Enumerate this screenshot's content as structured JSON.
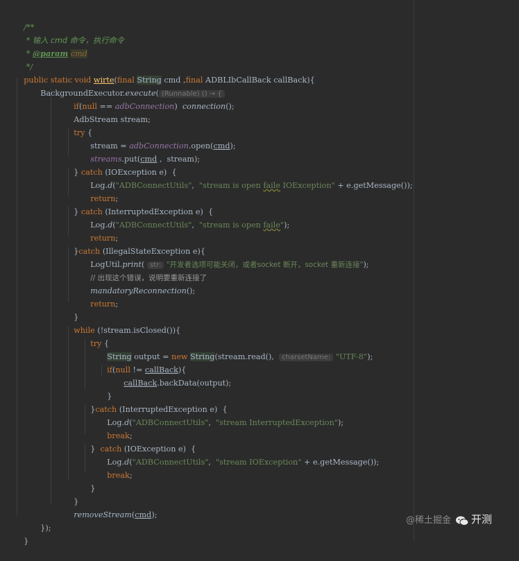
{
  "editor": {
    "lines": [
      {
        "doc_open": "/**"
      },
      {
        "doc_star": " * ",
        "doc_text": "输入 cmd 命令，执行命令"
      },
      {
        "doc_star": " * ",
        "doc_tag": "@param",
        "doc_param": "cmd"
      },
      {
        "doc_close": " */"
      },
      {
        "kw1": "public static void ",
        "name": "wirte",
        "p1": "(",
        "kw2": "final ",
        "t1": "String",
        "v1": " cmd ,",
        "kw3": "final ",
        "t2": "ADBLIbCallBack",
        "v2": " callBack){"
      },
      {
        "t": "BackgroundExecutor.",
        "i": "execute",
        "p": "(",
        "hint": "(Runnable) () → {"
      },
      {
        "kw": "if",
        "p1": "(",
        "kw2": "null",
        "p2": " == ",
        "f": "adbConnection",
        "p3": ")  ",
        "i": "connection",
        "p4": "();"
      },
      {
        "t": "AdbStream stream;"
      },
      {
        "kw": "try",
        "t": " {"
      },
      {
        "t": "stream = ",
        "f": "adbConnection",
        "t2": ".open(",
        "u": "cmd",
        "t3": ");"
      },
      {
        "f": "streams",
        "t": ".put(",
        "u": "cmd",
        "t2": " ,  stream);"
      },
      {
        "t1": "} ",
        "kw": "catch",
        "t2": " (IOException e)  {"
      },
      {
        "t": "Log.",
        "i": "d",
        "t2": "(",
        "s1": "\"ADBConnectUtils\"",
        "t3": ",  ",
        "s2": "\"stream is open ",
        "w": "faile",
        "s3": " IOException\"",
        "t4": " + e.getMessage());"
      },
      {
        "kw": "return",
        "t": ";"
      },
      {
        "t1": "} ",
        "kw": "catch",
        "t2": " (InterruptedException e)  {"
      },
      {
        "t": "Log.",
        "i": "d",
        "t2": "(",
        "s1": "\"ADBConnectUtils\"",
        "t3": ",  ",
        "s2": "\"stream is open ",
        "w": "faile",
        "s3": "\"",
        "t4": ");"
      },
      {
        "kw": "return",
        "t": ";"
      },
      {
        "t1": "}",
        "kw": "catch",
        "t2": " (IllegalStateException e){"
      },
      {
        "t": "LogUtil.",
        "i": "print",
        "t2": "( ",
        "hint": "str:",
        "s": " \"开发者选项可能关闭，或者socket 断开，socket 重新连接\"",
        "t3": ");"
      },
      {
        "c": "// 出现这个错误，说明要重新连接了"
      },
      {
        "i": "mandatoryReconnection",
        "t": "();"
      },
      {
        "kw": "return",
        "t": ";"
      },
      {
        "t": "}"
      },
      {
        "kw": "while",
        "t": " (!stream.isClosed()){"
      },
      {
        "kw": "try",
        "t": " {"
      },
      {
        "t1": "String",
        "t2": " output = ",
        "kw": "new ",
        "t3": "String",
        "t4": "(stream.read(),  ",
        "hint": "charsetName:",
        "s": " \"UTF-8\"",
        "t5": ");"
      },
      {
        "kw": "if",
        "t": "(",
        "kw2": "null",
        "t2": " != ",
        "u": "callBack",
        "t3": "){"
      },
      {
        "u": "callBack",
        "t": ".backData(output);"
      },
      {
        "t": "}"
      },
      {
        "t1": "}",
        "kw": "catch",
        "t2": " (InterruptedException e)  {"
      },
      {
        "t": "Log.",
        "i": "d",
        "t2": "(",
        "s1": "\"ADBConnectUtils\"",
        "t3": ",  ",
        "s2": "\"stream InterruptedException\"",
        "t4": ");"
      },
      {
        "kw": "break",
        "t": ";"
      },
      {
        "t1": "}  ",
        "kw": "catch",
        "t2": " (IOException e)  {"
      },
      {
        "t": "Log.",
        "i": "d",
        "t2": "(",
        "s1": "\"ADBConnectUtils\"",
        "t3": ",  ",
        "s2": "\"stream IOException\"",
        "t4": " + e.getMessage());"
      },
      {
        "kw": "break",
        "t": ";"
      },
      {
        "t": "}"
      },
      {
        "t": "}"
      },
      {
        "i": "removeStream",
        "t": "(",
        "u": "cmd",
        "t2": ");"
      },
      {
        "t": "});"
      },
      {
        "t": "}"
      }
    ]
  },
  "watermark": {
    "prefix": "@稀土掘金",
    "icon": "wechat-icon",
    "brand": "开测"
  }
}
